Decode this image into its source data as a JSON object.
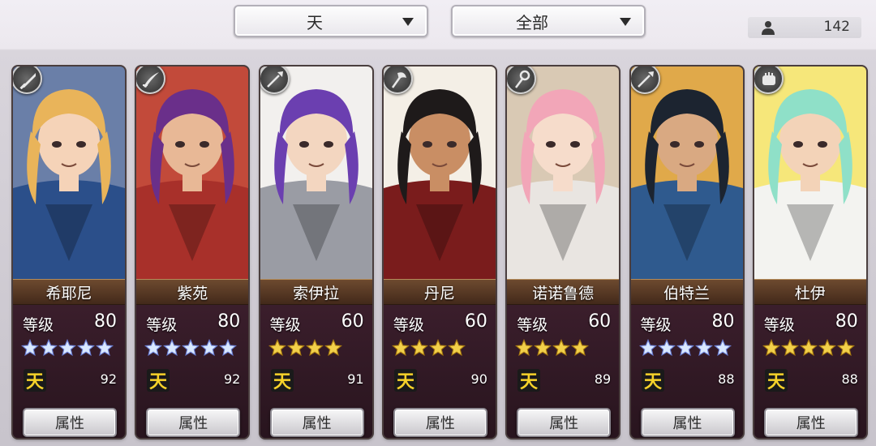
{
  "filters": {
    "rank_filter": "天",
    "category_filter": "全部"
  },
  "unit_count": "142",
  "colors": {
    "gold_star": "#f2d04a",
    "blue_star": "#d9e8ff",
    "name_bar": "#5a3a24",
    "tian_badge": "#f6d22a"
  },
  "cards": [
    {
      "name": "希耶尼",
      "level_label": "等级",
      "level": "80",
      "stars": 5,
      "star_color": "blue",
      "rank_icon": "天",
      "power": "92",
      "attr_label": "属性",
      "weapon_icon": "sword-icon",
      "palette": {
        "hair": "#e9b45a",
        "skin": "#f5d3b8",
        "cloth": "#2b4f8a",
        "bg": "#6a7fa8"
      }
    },
    {
      "name": "紫苑",
      "level_label": "等级",
      "level": "80",
      "stars": 5,
      "star_color": "blue",
      "rank_icon": "天",
      "power": "92",
      "attr_label": "属性",
      "weapon_icon": "katana-icon",
      "palette": {
        "hair": "#6a2f8a",
        "skin": "#e8b896",
        "cloth": "#a8302a",
        "bg": "#c24a3a"
      }
    },
    {
      "name": "索伊拉",
      "level_label": "等级",
      "level": "60",
      "stars": 4,
      "star_color": "gold",
      "rank_icon": "天",
      "power": "91",
      "attr_label": "属性",
      "weapon_icon": "spear-icon",
      "palette": {
        "hair": "#6b3fb0",
        "skin": "#f3d6c0",
        "cloth": "#9a9ca4",
        "bg": "#f2f0ee"
      }
    },
    {
      "name": "丹尼",
      "level_label": "等级",
      "level": "60",
      "stars": 4,
      "star_color": "gold",
      "rank_icon": "天",
      "power": "90",
      "attr_label": "属性",
      "weapon_icon": "axe-icon",
      "palette": {
        "hair": "#1e1a1a",
        "skin": "#c98e64",
        "cloth": "#7a1c1c",
        "bg": "#f4efe6"
      }
    },
    {
      "name": "诺诺鲁德",
      "level_label": "等级",
      "level": "60",
      "stars": 4,
      "star_color": "gold",
      "rank_icon": "天",
      "power": "89",
      "attr_label": "属性",
      "weapon_icon": "staff-icon",
      "palette": {
        "hair": "#f2a6b8",
        "skin": "#f6dccb",
        "cloth": "#e9e5e1",
        "bg": "#d9c9b4"
      }
    },
    {
      "name": "伯特兰",
      "level_label": "等级",
      "level": "80",
      "stars": 5,
      "star_color": "blue",
      "rank_icon": "天",
      "power": "88",
      "attr_label": "属性",
      "weapon_icon": "spear-icon",
      "palette": {
        "hair": "#1c2430",
        "skin": "#d9a982",
        "cloth": "#2f5a8e",
        "bg": "#e0a94a"
      }
    },
    {
      "name": "杜伊",
      "level_label": "等级",
      "level": "80",
      "stars": 5,
      "star_color": "gold",
      "rank_icon": "天",
      "power": "88",
      "attr_label": "属性",
      "weapon_icon": "fist-icon",
      "palette": {
        "hair": "#8fe0c8",
        "skin": "#f3d3b8",
        "cloth": "#f3f3f0",
        "bg": "#f6e77a"
      }
    }
  ]
}
